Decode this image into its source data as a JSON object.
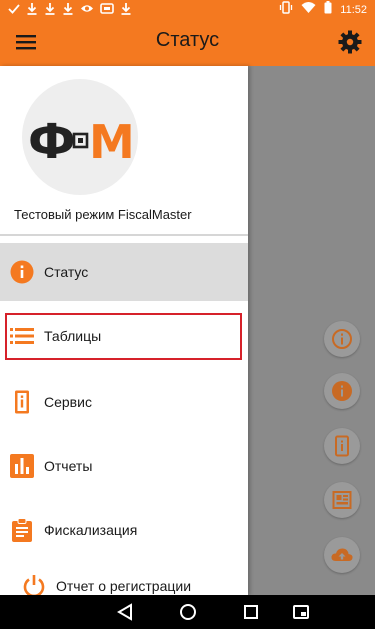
{
  "status_bar": {
    "time": "11:52"
  },
  "app_bar": {
    "title": "Статус"
  },
  "drawer": {
    "logo": "Ф▫М",
    "mode_label": "Тестовый режим FiscalMaster",
    "items": [
      {
        "label": "Статус",
        "icon": "info-circle-icon",
        "active": true
      },
      {
        "label": "Таблицы",
        "icon": "list-icon",
        "active": false
      },
      {
        "label": "Сервис",
        "icon": "service-device-icon",
        "active": false
      },
      {
        "label": "Отчеты",
        "icon": "bar-chart-icon",
        "active": false
      },
      {
        "label": "Фискализация",
        "icon": "clipboard-icon",
        "active": false
      },
      {
        "label": "Отчет о регистрации",
        "icon": "power-icon",
        "active": false
      }
    ]
  },
  "fab_icons": [
    "info-outline-icon",
    "info-circle-icon",
    "service-device-icon",
    "register-icon",
    "cloud-upload-icon"
  ],
  "colors": {
    "accent": "#f47920",
    "highlight": "#d6212a",
    "logo_dark": "#222222",
    "logo_accent": "#f47920"
  }
}
